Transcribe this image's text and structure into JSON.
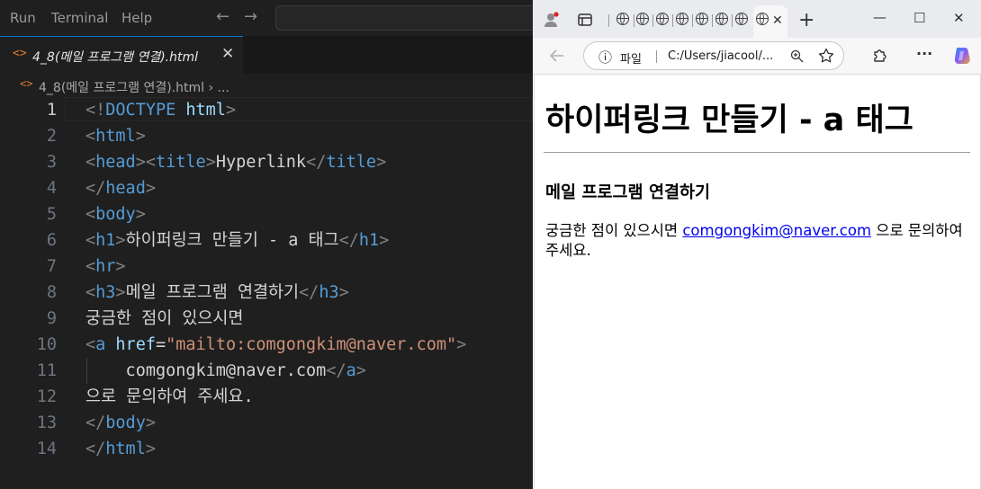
{
  "menubar": {
    "items": [
      "Run",
      "Terminal",
      "Help"
    ]
  },
  "editor_tab": {
    "icon": "<>",
    "label": "4_8(메일 프로그램 연결).html",
    "close": "✕"
  },
  "breadcrumb": {
    "icon": "<>",
    "label": "4_8(메일 프로그램 연결).html › ..."
  },
  "code": {
    "line_numbers": [
      "1",
      "2",
      "3",
      "4",
      "5",
      "6",
      "7",
      "8",
      "9",
      "10",
      "11",
      "12",
      "13",
      "14"
    ],
    "lines": [
      {
        "segs": [
          [
            "tg",
            "<!"
          ],
          [
            "tn",
            "DOCTYPE"
          ],
          [
            "tx",
            " "
          ],
          [
            "an",
            "html"
          ],
          [
            "tg",
            ">"
          ]
        ]
      },
      {
        "segs": [
          [
            "tg",
            "<"
          ],
          [
            "tn",
            "html"
          ],
          [
            "tg",
            ">"
          ]
        ]
      },
      {
        "segs": [
          [
            "tg",
            "<"
          ],
          [
            "tn",
            "head"
          ],
          [
            "tg",
            "><"
          ],
          [
            "tn",
            "title"
          ],
          [
            "tg",
            ">"
          ],
          [
            "tx",
            "Hyperlink"
          ],
          [
            "tg",
            "</"
          ],
          [
            "tn",
            "title"
          ],
          [
            "tg",
            ">"
          ]
        ]
      },
      {
        "segs": [
          [
            "tg",
            "</"
          ],
          [
            "tn",
            "head"
          ],
          [
            "tg",
            ">"
          ]
        ]
      },
      {
        "segs": [
          [
            "tg",
            "<"
          ],
          [
            "tn",
            "body"
          ],
          [
            "tg",
            ">"
          ]
        ]
      },
      {
        "segs": [
          [
            "tg",
            "<"
          ],
          [
            "tn",
            "h1"
          ],
          [
            "tg",
            ">"
          ],
          [
            "tx",
            "하이퍼링크 만들기 - a 태그"
          ],
          [
            "tg",
            "</"
          ],
          [
            "tn",
            "h1"
          ],
          [
            "tg",
            ">"
          ]
        ]
      },
      {
        "segs": [
          [
            "tg",
            "<"
          ],
          [
            "tn",
            "hr"
          ],
          [
            "tg",
            ">"
          ]
        ]
      },
      {
        "segs": [
          [
            "tg",
            "<"
          ],
          [
            "tn",
            "h3"
          ],
          [
            "tg",
            ">"
          ],
          [
            "tx",
            "메일 프로그램 연결하기"
          ],
          [
            "tg",
            "</"
          ],
          [
            "tn",
            "h3"
          ],
          [
            "tg",
            ">"
          ]
        ]
      },
      {
        "segs": [
          [
            "tx",
            "궁금한 점이 있으시면"
          ]
        ]
      },
      {
        "segs": [
          [
            "tg",
            "<"
          ],
          [
            "tn",
            "a"
          ],
          [
            "tx",
            " "
          ],
          [
            "an",
            "href"
          ],
          [
            "tx",
            "="
          ],
          [
            "av",
            "\"mailto:comgongkim@naver.com\""
          ],
          [
            "tg",
            ">"
          ]
        ]
      },
      {
        "segs": [
          [
            "tx",
            "    comgongkim@naver.com"
          ],
          [
            "tg",
            "</"
          ],
          [
            "tn",
            "a"
          ],
          [
            "tg",
            ">"
          ]
        ]
      },
      {
        "segs": [
          [
            "tx",
            "으로 문의하여 주세요."
          ]
        ]
      },
      {
        "segs": [
          [
            "tg",
            "</"
          ],
          [
            "tn",
            "body"
          ],
          [
            "tg",
            ">"
          ]
        ]
      },
      {
        "segs": [
          [
            "tg",
            "</"
          ],
          [
            "tn",
            "html"
          ],
          [
            "tg",
            ">"
          ]
        ]
      }
    ]
  },
  "browser": {
    "tab_close": "✕",
    "new_tab": "+",
    "window_controls": {
      "minimize": "—",
      "maximize": "☐",
      "close": "✕"
    },
    "address": {
      "info_icon": "ⓘ",
      "scheme_label": "파일",
      "url": "C:/Users/jiacool/..."
    },
    "toolbar_icons": [
      "back-icon",
      "zoom-icon",
      "favorite-star-icon",
      "extensions-icon",
      "more-icon",
      "copilot-icon"
    ],
    "more": "···",
    "page": {
      "h1": "하이퍼링크 만들기 - a 태그",
      "h3": "메일 프로그램 연결하기",
      "text_before": "궁금한 점이 있으시면 ",
      "link_text": "comgongkim@naver.com",
      "text_after": " 으로 문의하여 주세요."
    }
  },
  "colors": {
    "accent": "#0078d4",
    "link": "#0000ee",
    "tag_name": "#569cd6",
    "attr_name": "#9cdcfe",
    "attr_value": "#ce9178"
  }
}
